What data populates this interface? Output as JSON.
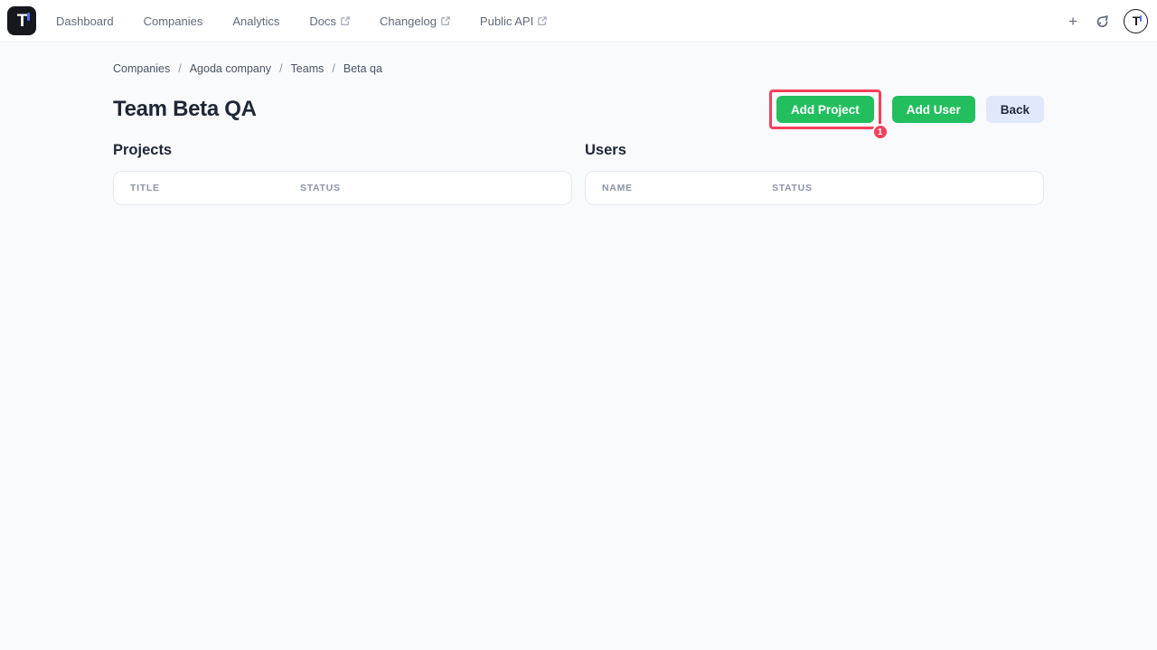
{
  "nav": {
    "logo_letter": "T",
    "items": [
      {
        "label": "Dashboard",
        "external": false
      },
      {
        "label": "Companies",
        "external": false
      },
      {
        "label": "Analytics",
        "external": false
      },
      {
        "label": "Docs",
        "external": true
      },
      {
        "label": "Changelog",
        "external": true
      },
      {
        "label": "Public API",
        "external": true
      }
    ],
    "plus_label": "+"
  },
  "breadcrumb": {
    "separator": "/",
    "items": [
      "Companies",
      "Agoda company",
      "Teams",
      "Beta qa"
    ]
  },
  "page": {
    "title": "Team Beta QA"
  },
  "actions": {
    "add_project_label": "Add Project",
    "add_user_label": "Add User",
    "back_label": "Back",
    "annotation_badge": "1"
  },
  "projects": {
    "heading": "Projects",
    "columns": [
      "TITLE",
      "STATUS"
    ],
    "rows": []
  },
  "users": {
    "heading": "Users",
    "columns": [
      "NAME",
      "STATUS"
    ],
    "rows": []
  },
  "colors": {
    "accent_green": "#23bf5f",
    "annotation_red": "#f5405a",
    "back_button_bg": "#e2e8fb",
    "logo_accent_blue": "#4f6ef7",
    "page_bg": "#f8fafc"
  }
}
